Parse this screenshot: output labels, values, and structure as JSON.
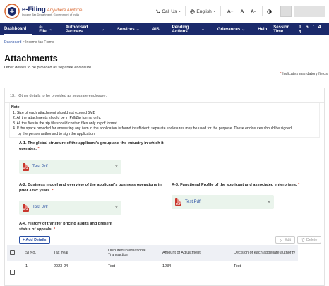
{
  "header": {
    "brand_title": "e-Filing",
    "brand_hindi": "Anywhere Anytime",
    "brand_sub": "Income Tax Department, Government of India",
    "call_us": "Call Us",
    "language": "English",
    "font_increase": "A+",
    "font_normal": "A",
    "font_decrease": "A-"
  },
  "nav": {
    "items": [
      "Dashboard",
      "e-File",
      "Authorised Partners",
      "Services",
      "AIS",
      "Pending Actions",
      "Grievances",
      "Help"
    ],
    "session_label": "Session Time",
    "session_value": "1 6 : 4 4"
  },
  "breadcrumb": {
    "home": "Dashboard",
    "current": "Income-tax Forms"
  },
  "page": {
    "title": "Attachments",
    "subtitle": "Other details to be provided as separate enclosure",
    "mandatory_note": "Indicates mandatory fields"
  },
  "question": {
    "number": "13.",
    "text": "Other details to be provided as separate enclosure."
  },
  "notes": {
    "title": "Note:",
    "items": [
      "1. Size of each attachment should not exceed 5MB",
      "2. All the attachments should be in Pdf/Zip format only.",
      "3. All the files in the zip file should contain files only in pdf format.",
      "4. If the space provided for answering any item in the application is found insufficient, separate enclosures may be used for the purpose. These enclosures should be signed",
      "by the person authorised to sign the application."
    ]
  },
  "sections": {
    "a1": {
      "label_line1": "A-1. The global structure of the applicant's group and the industry in which it",
      "label_line2": "operates.",
      "file": "Test.Pdf"
    },
    "a2": {
      "label_line1": "A-2. Business model and overview of the applicant's business operations in",
      "label_line2": "prior 3 tax years.",
      "file": "Test.Pdf"
    },
    "a3": {
      "label_line1": "A-3. Functional Profile of the applicant and associated enterprises.",
      "file": "Test.Pdf"
    },
    "a4": {
      "label_line1": "A-4. History of transfer pricing audits and present",
      "label_line2": "status of appeals."
    }
  },
  "actions": {
    "add": "+ Add Details",
    "edit": "Edit",
    "delete": "Delete"
  },
  "table": {
    "headers": [
      "Sl No.",
      "Tax Year",
      "Disputed International Transaction",
      "Amount of Adjustment",
      "Decision of each appellate authority"
    ],
    "rows": [
      {
        "sl": "1",
        "tax_year": "2023-24",
        "transaction": "Test",
        "amount": "1234",
        "decision": "Test"
      }
    ]
  },
  "colors": {
    "nav_bg": "#1b2a6b",
    "accent": "#2a4fa3",
    "required": "#d0311f",
    "file_bg": "#eaf4ec"
  }
}
